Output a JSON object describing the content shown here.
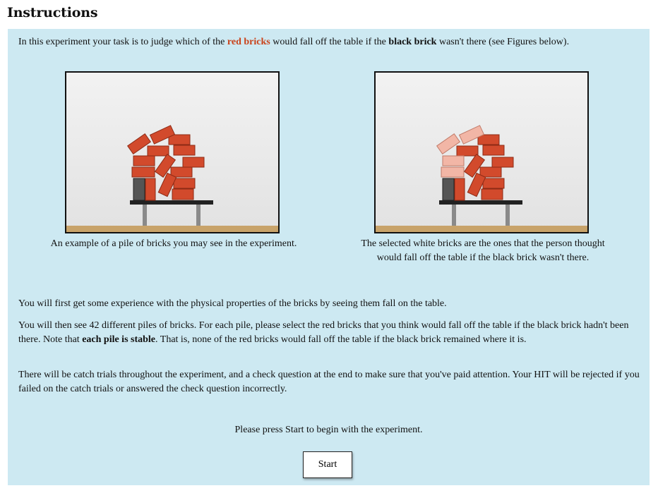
{
  "header": {
    "title": "Instructions"
  },
  "intro": {
    "part1": "In this experiment your task is to judge which of the ",
    "red_bricks": "red bricks",
    "part2": " would fall off the table if the ",
    "black_brick": "black brick",
    "part3": " wasn't there (see Figures below)."
  },
  "figures": [
    {
      "caption": "An example of a pile of bricks you may see in the experiment."
    },
    {
      "caption": "The selected white bricks are the ones that the person thought would fall off the table if the black brick wasn't there."
    }
  ],
  "paragraphs": {
    "experience": "You will first get some experience with the physical properties of the bricks by seeing them fall on the table.",
    "piles_part1": "You will then see 42 different piles of bricks. For each pile, please select the red bricks that you think would fall off the table if the black brick hadn't been there. Note that ",
    "piles_bold": "each pile is stable",
    "piles_part2": ". That is, none of the red bricks would fall off the table if the black brick remained where it is.",
    "catch": "There will be catch trials throughout the experiment, and a check question at the end to make sure that you've paid attention. Your HIT will be rejected if you failed on the catch trials or answered the check question incorrectly."
  },
  "prompt": "Please press Start to begin with the experiment.",
  "start_button": {
    "label": "Start"
  },
  "colors": {
    "panel_bg": "#cde9f2",
    "red_text": "#c9421a",
    "brick_red": "#d24a2c",
    "brick_white": "#f2b6a6",
    "black_brick": "#4a4a4a",
    "floor": "#c8a36a"
  }
}
